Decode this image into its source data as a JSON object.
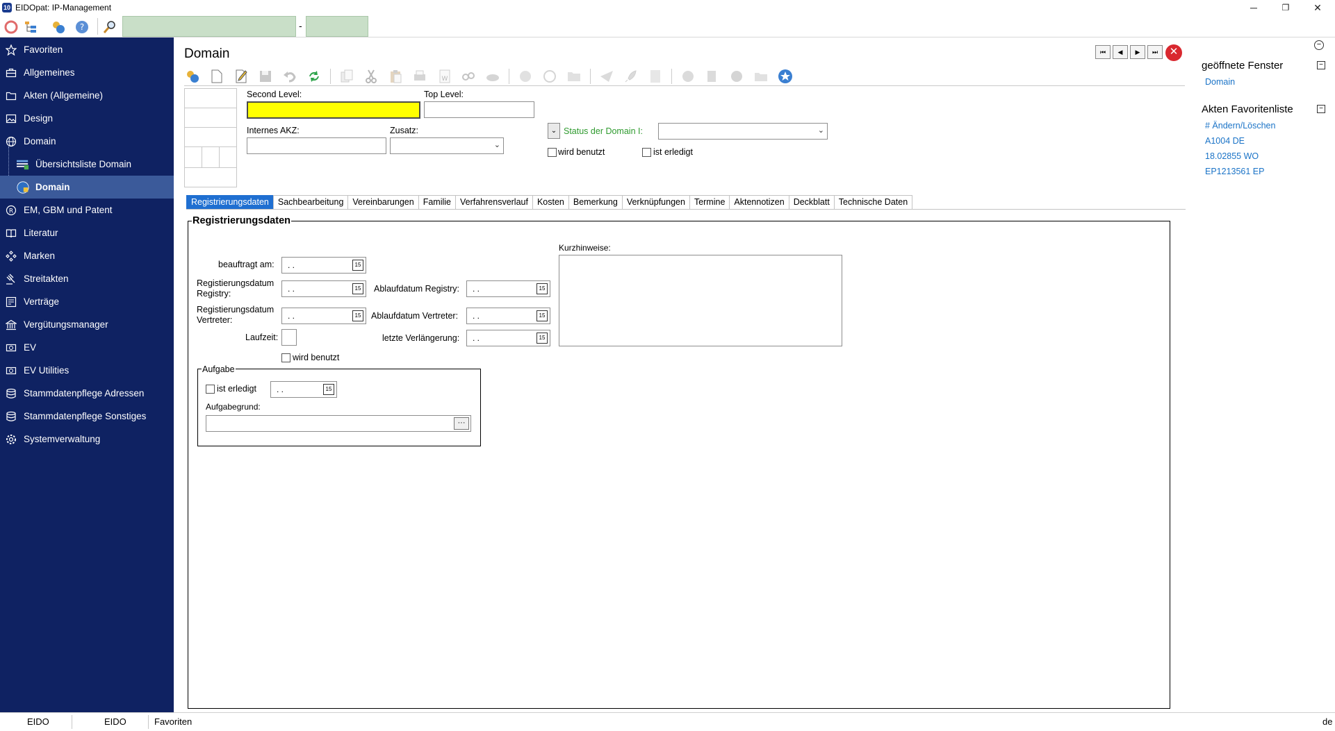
{
  "window": {
    "title": "EIDOpat: IP-Management",
    "minimize": "─",
    "maximize": "❐",
    "close": "✕"
  },
  "quickbar": {
    "separator": "-"
  },
  "sidebar": {
    "items": [
      {
        "label": "Favoriten",
        "icon": "star-icon"
      },
      {
        "label": "Allgemeines",
        "icon": "briefcase-icon"
      },
      {
        "label": "Akten (Allgemeine)",
        "icon": "folder-icon"
      },
      {
        "label": "Design",
        "icon": "image-icon"
      },
      {
        "label": "Domain",
        "icon": "globe-icon"
      },
      {
        "label": "Übersichtsliste Domain",
        "icon": "list-icon"
      },
      {
        "label": "Domain",
        "icon": "globe-lock-icon"
      },
      {
        "label": "EM, GBM und Patent",
        "icon": "registered-icon"
      },
      {
        "label": "Literatur",
        "icon": "book-icon"
      },
      {
        "label": "Marken",
        "icon": "diamonds-icon"
      },
      {
        "label": "Streitakten",
        "icon": "gavel-icon"
      },
      {
        "label": "Verträge",
        "icon": "contract-icon"
      },
      {
        "label": "Vergütungsmanager",
        "icon": "bank-icon"
      },
      {
        "label": "EV",
        "icon": "ev-icon"
      },
      {
        "label": "EV Utilities",
        "icon": "ev-utilities-icon"
      },
      {
        "label": "Stammdatenpflege Adressen",
        "icon": "database-icon"
      },
      {
        "label": "Stammdatenpflege Sonstiges",
        "icon": "database-icon"
      },
      {
        "label": "Systemverwaltung",
        "icon": "gear-icon"
      }
    ]
  },
  "main": {
    "title": "Domain",
    "nav": {
      "first": "⏮",
      "prev": "◀",
      "next": "▶",
      "last": "⏭",
      "close": "✕"
    },
    "header": {
      "second_level_label": "Second Level:",
      "second_level_value": "",
      "top_level_label": "Top Level:",
      "top_level_value": "",
      "internes_akz_label": "Internes AKZ:",
      "zusatz_label": "Zusatz:",
      "status_label": "Status der Domain I:",
      "wird_benutzt_label": "wird  benutzt",
      "ist_erledigt_label": "ist erledigt"
    },
    "tabs": [
      {
        "label": "Registrierungsdaten",
        "active": true
      },
      {
        "label": "Sachbearbeitung"
      },
      {
        "label": "Vereinbarungen"
      },
      {
        "label": "Familie"
      },
      {
        "label": "Verfahrensverlauf"
      },
      {
        "label": "Kosten"
      },
      {
        "label": "Bemerkung"
      },
      {
        "label": "Verknüpfungen"
      },
      {
        "label": "Termine"
      },
      {
        "label": "Aktennotizen"
      },
      {
        "label": "Deckblatt"
      },
      {
        "label": "Technische Daten"
      }
    ],
    "reg": {
      "group_title": "Registrierungsdaten",
      "beauftragt_label": "beauftragt am:",
      "reg_registry_label": "Registierungsdatum Registry:",
      "reg_vertreter_label": "Registierungsdatum Vertreter:",
      "laufzeit_label": "Laufzeit:",
      "wird_benutzt_label": "wird benutzt",
      "ablauf_registry_label": "Ablaufdatum Registry:",
      "ablauf_vertreter_label": "Ablaufdatum Vertreter:",
      "letzte_verl_label": "letzte Verlängerung:",
      "kurzhinweise_label": "Kurzhinweise:",
      "empty_date": ". .",
      "aufgabe_title": "Aufgabe",
      "aufgabe_ist_erledigt_label": "ist erledigt",
      "aufgabegrund_label": "Aufgabegrund:",
      "dots": "···"
    }
  },
  "rightpanel": {
    "open_windows_title": "geöffnete Fenster",
    "open_windows": [
      "Domain"
    ],
    "favorites_title": "Akten Favoritenliste",
    "favorites": [
      "# Ändern/Löschen",
      "A1004 DE",
      "18.02855 WO",
      "EP1213561 EP"
    ],
    "collapse": "−"
  },
  "statusbar": {
    "cell1": "EIDO",
    "cell2": "EIDO",
    "cell3": "Favoriten",
    "lang": "de"
  },
  "colors": {
    "sidebar_bg": "#0f2262",
    "active_tab": "#1f6fd1",
    "highlight_field": "#ffff00",
    "link": "#1a73c7",
    "status_label": "#2e9a2e"
  }
}
